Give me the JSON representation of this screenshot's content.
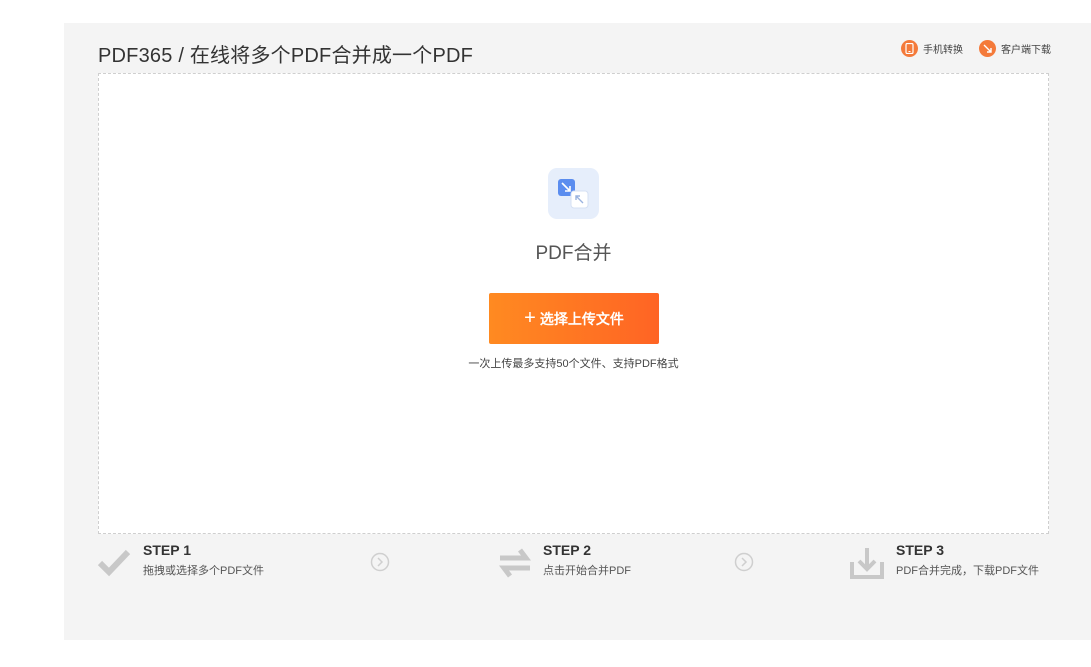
{
  "header": {
    "title": "PDF365 / 在线将多个PDF合并成一个PDF",
    "links": [
      {
        "label": "手机转换",
        "icon": "phone-icon"
      },
      {
        "label": "客户端下载",
        "icon": "download-client-icon"
      }
    ]
  },
  "upload": {
    "feature_name": "PDF合并",
    "button_label": "选择上传文件",
    "hint": "一次上传最多支持50个文件、支持PDF格式"
  },
  "steps": [
    {
      "title": "STEP 1",
      "desc": "拖拽或选择多个PDF文件",
      "icon": "checkmark-icon"
    },
    {
      "title": "STEP 2",
      "desc": "点击开始合并PDF",
      "icon": "swap-arrows-icon"
    },
    {
      "title": "STEP 3",
      "desc": "PDF合并完成，下载PDF文件",
      "icon": "download-tray-icon"
    }
  ],
  "colors": {
    "accent": "#ff7524",
    "icon_gray": "#c8c8c8",
    "panel_bg": "#f4f4f4"
  }
}
